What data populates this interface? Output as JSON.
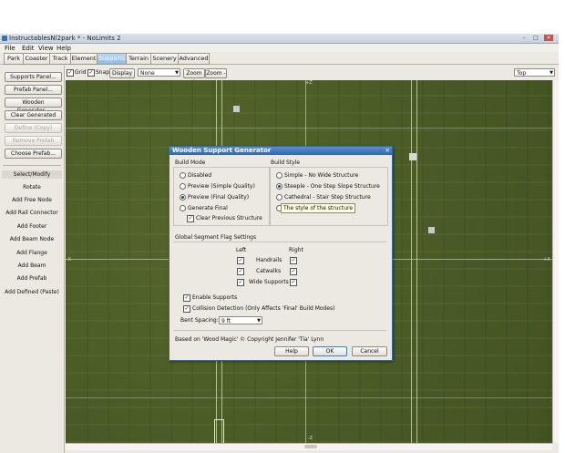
{
  "window": {
    "title": "InstructablesNl2park * - NoLimits 2",
    "controls": [
      "–",
      "□",
      "×"
    ]
  },
  "menu": [
    "File",
    "Edit",
    "View",
    "Help"
  ],
  "tabs": [
    "Park",
    "Coaster",
    "Track",
    "Element",
    "Supports",
    "Terrain",
    "Scenery",
    "Advanced"
  ],
  "active_tab": "Supports",
  "sidebar": {
    "buttons": [
      "Supports Panel...",
      "Prefab Panel...",
      "Wooden Generator...",
      "Clear Generated",
      "Define (Copy)",
      "Remove Prefab",
      "Choose Prefab..."
    ],
    "tools": [
      "Select/Modify",
      "Rotate",
      "Add Free Node",
      "Add Rail Connector",
      "Add Footer",
      "Add Beam Node",
      "Add Flange",
      "Add Beam",
      "Add Prefab",
      "Add Defined (Paste)"
    ]
  },
  "toolbar": {
    "grid_label": "Grid",
    "snap_label": "Snap",
    "display_label": "Display",
    "none_value": "None",
    "zoom_in": "Zoom +",
    "zoom_out": "Zoom -",
    "view_value": "Top"
  },
  "viewport": {
    "top_axis": "+Z",
    "bottom_axis": "-Z",
    "left_axis": "-X",
    "right_axis": "+X"
  },
  "dialog": {
    "title": "Wooden Support Generator",
    "close": "×",
    "build_mode": {
      "label": "Build Mode",
      "options": [
        "Disabled",
        "Preview (Simple Quality)",
        "Preview (Final Quality)",
        "Generate Final"
      ],
      "selected": "Preview (Final Quality)",
      "clear_previous": "Clear Previous Structure"
    },
    "build_style": {
      "label": "Build Style",
      "options": [
        "Simple - No Wide Structure",
        "Steeple - One Step Slope Structure",
        "Cathedral - Stair Step Structure",
        ""
      ],
      "selected": "Steeple - One Step Slope Structure",
      "tooltip": "The style of the structure"
    },
    "flags": {
      "label": "Global Segment Flag Settings",
      "left_header": "Left",
      "right_header": "Right",
      "rows": [
        "Handrails",
        "Catwalks",
        "Wide Supports"
      ]
    },
    "enable_supports": "Enable Supports",
    "collision_detection": "Collision Detection (Only Affects 'Final' Build Modes)",
    "bent_spacing_label": "Bent Spacing:",
    "bent_spacing_value": "9 ft",
    "credit": "Based on 'Wood Magic' © Copyright Jennifer 'Tia' Lynn",
    "buttons": {
      "help": "Help",
      "ok": "OK",
      "cancel": "Cancel"
    }
  }
}
